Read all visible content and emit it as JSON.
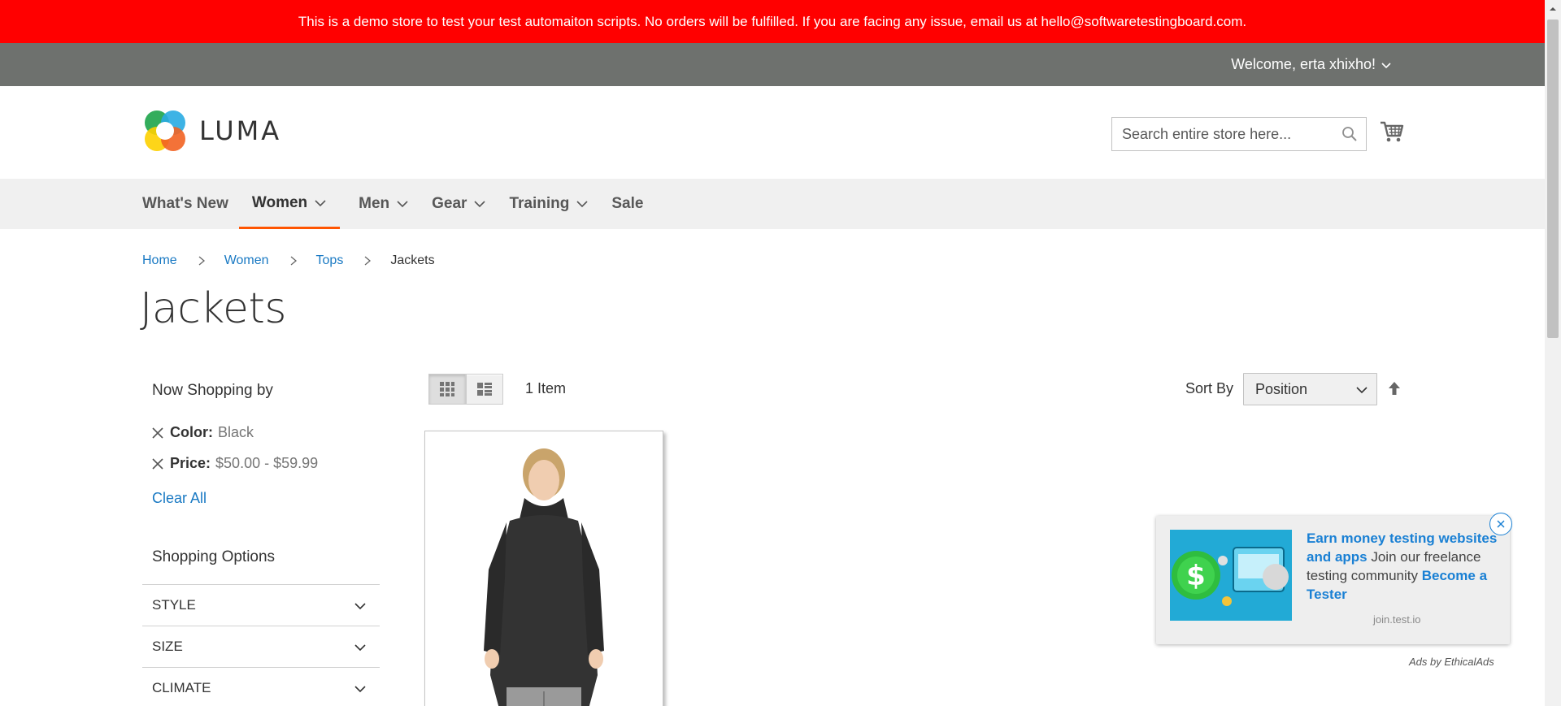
{
  "demo_banner": "This is a demo store to test your test automaiton scripts. No orders will be fulfilled. If you are facing any issue, email us at hello@softwaretestingboard.com.",
  "header": {
    "welcome": "Welcome, erta xhixho!",
    "logo_text": "LUMA",
    "search_placeholder": "Search entire store here...",
    "icons": {
      "search": "magnifier-icon",
      "cart": "shopping-cart-icon"
    }
  },
  "nav": {
    "items": [
      {
        "label": "What's New"
      },
      {
        "label": "Women",
        "active": true
      },
      {
        "label": "Men"
      },
      {
        "label": "Gear"
      },
      {
        "label": "Training"
      },
      {
        "label": "Sale"
      }
    ],
    "accent_color": "#ff5501"
  },
  "breadcrumb": {
    "items": [
      "Home",
      "Women",
      "Tops"
    ],
    "current": "Jackets"
  },
  "page_title": "Jackets",
  "sidebar": {
    "now_shopping": "Now Shopping by",
    "filters": [
      {
        "label": "Color:",
        "value": "Black"
      },
      {
        "label": "Price:",
        "value": "$50.00 - $59.99"
      }
    ],
    "clear_all": "Clear All",
    "shopping_options_title": "Shopping Options",
    "options": [
      "STYLE",
      "SIZE",
      "CLIMATE"
    ]
  },
  "toolbar": {
    "item_count": "1 Item",
    "sort_label": "Sort By",
    "sort_value": "Position",
    "view_modes": [
      "grid",
      "list"
    ],
    "active_mode": "grid"
  },
  "ad": {
    "headline": "Earn money testing websites and apps",
    "body": " Join our freelance testing community ",
    "cta": "Become a Tester",
    "domain": "join.test.io",
    "ads_by": "Ads by EthicalAds"
  },
  "colors": {
    "banner": "#ff0000",
    "top_bar": "#6e716e",
    "link": "#1979c3",
    "nav_bg": "#f0f0f0"
  }
}
